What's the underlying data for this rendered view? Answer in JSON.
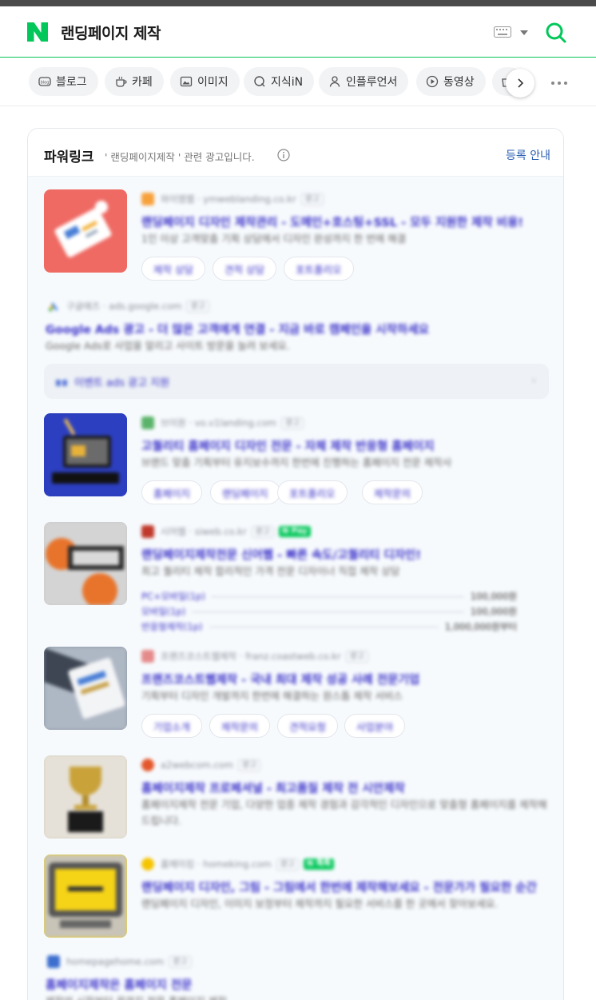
{
  "search": {
    "query": "랜딩페이지 제작"
  },
  "tabs": [
    {
      "label": "블로그",
      "icon": "blog-icon"
    },
    {
      "label": "카페",
      "icon": "cafe-icon"
    },
    {
      "label": "이미지",
      "icon": "image-icon"
    },
    {
      "label": "지식iN",
      "icon": "kin-icon"
    },
    {
      "label": "인플루언서",
      "icon": "person-icon"
    },
    {
      "label": "동영상",
      "icon": "play-icon"
    },
    {
      "label": "",
      "icon": "shopping-icon"
    }
  ],
  "powerlink": {
    "title": "파워링크",
    "subtitle": "' 랜딩페이지제작 ' 관련 광고입니다.",
    "register_label": "등록 안내"
  },
  "ads": [
    {
      "site": "와이엠웹",
      "url": "ymweblanding.co.kr",
      "badge": "광고",
      "title": "랜딩페이지 디자인 제작관리 - 도메인+호스팅+SSL - 모두 지원한 제작 비용!",
      "desc": "1인 이상 고객맞춤 기획 상담에서 디자인 완성까지 한 번에 해결",
      "chips": [
        "제작 상담",
        "견적 상담",
        "포트폴리오"
      ],
      "thumb_color": "#ef6a63"
    },
    {
      "site": "구글애즈",
      "url": "ads.google.com",
      "badge": "광고",
      "title": "Google Ads 광고 - 더 많은 고객에게 연결 - 지금 바로 캠페인을 시작하세요",
      "desc": "Google Ads로 사업을 알리고 사이트 방문을 늘려 보세요.",
      "event": "이벤트 ads 광고 지원"
    },
    {
      "site": "브이원",
      "url": "vo.v1landing.com",
      "badge": "광고",
      "title": "고퀄리티 홈페이지 디자인 전문 - 자체 제작 반응형 홈페이지",
      "desc": "브랜드 맞춤 기획부터 유지보수까지 한번에 진행하는 홈페이지 전문 제작사",
      "chips": [
        "홈페이지",
        "랜딩페이지",
        "포트폴리오",
        "제작문의"
      ],
      "thumb_color": "#2a3db8"
    },
    {
      "site": "시어웹",
      "url": "siweb.co.kr",
      "badge": "광고",
      "npay": "N Pay",
      "title": "랜딩페이지제작전문 신어웹 - 빠른 속도/고퀄리티 디자인!",
      "desc": "최고 퀄리티 제작 합리적인 가격 전문 디자이너 직접 제작 상담",
      "prices": [
        {
          "label": "PC+모바일(1p)",
          "value": "100,000원"
        },
        {
          "label": "모바일(1p)",
          "value": "100,000원"
        },
        {
          "label": "반응형제작(1p)",
          "value": "1,000,000원부터"
        }
      ],
      "thumb_color": "#c9c9c9"
    },
    {
      "site": "프랜즈코스트웹제작",
      "url": "franz.coastweb.co.kr",
      "badge": "광고",
      "title": "프랜즈코스트웹제작 - 국내 최대 제작 성공 사례 전문기업",
      "desc": "기획부터 디자인 개발까지 한번에 해결하는 원스톱 제작 서비스",
      "chips": [
        "기업소개",
        "제작문의",
        "견적요청",
        "사업분야"
      ],
      "thumb_color": "#8b96a6"
    },
    {
      "site": "a2webcom",
      "url": "a2webcom.com",
      "badge": "광고",
      "title": "홈페이지제작 프로페셔널 - 최고품질 제작 전 시안제작",
      "desc": "홈페이지제작 전문 기업, 다양한 업종 제작 경험과 감각적인 디자인으로 맞춤형 홈페이지를 제작해 드립니다.",
      "thumb_color": "#d9d2c4"
    },
    {
      "site": "홈메이킹",
      "url": "homeking.com",
      "badge": "광고",
      "npay": "N 톡톡",
      "title": "랜딩페이지 디자인, 그림 - 그림에서 한번에 제작해보세요 - 전문가가 필요한 순간",
      "desc": "랜딩페이지 디자인, 이미지 보정부터 제작까지 필요한 서비스를 한 곳에서 찾아보세요.",
      "thumb_color": "#f3d21c"
    },
    {
      "site": "homepagehome.com",
      "url": "",
      "badge": "광고",
      "title": "홈페이지제작은 홈페이지 전문",
      "desc": "제작의 시작부터 끝까지 전문 홈페이지 제작"
    }
  ],
  "colors": {
    "brand": "#03c75a",
    "ad_title": "#3b32c9",
    "link": "#2a5fb3"
  }
}
